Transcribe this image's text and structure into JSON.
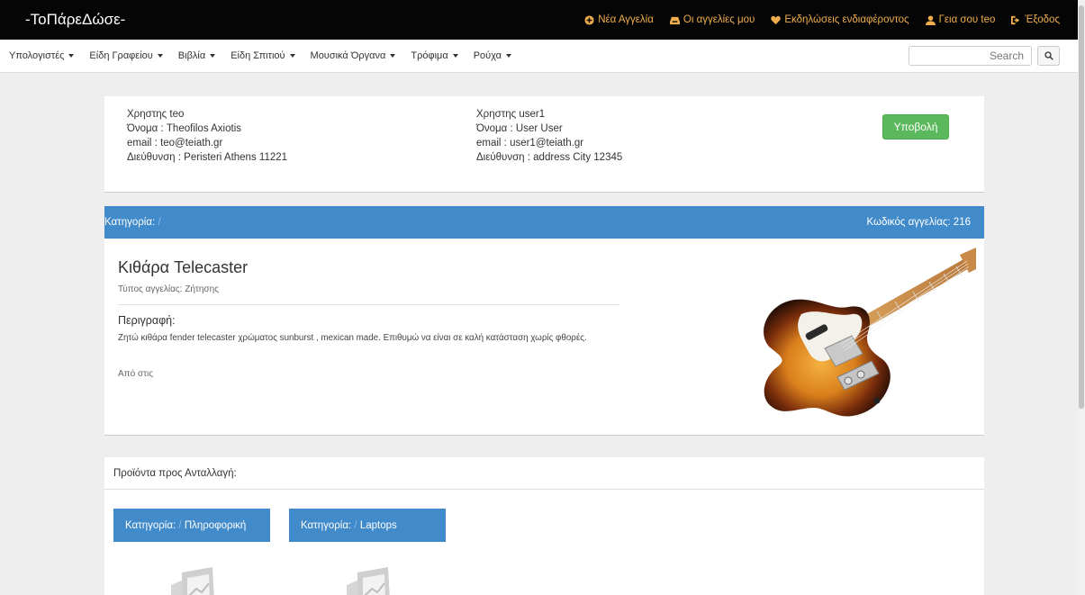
{
  "brand": "-ΤοΠάρεΔώσε-",
  "top_links": {
    "new_ad": "Νέα Αγγελία",
    "my_ads": "Οι αγγελίες μου",
    "interests": "Εκδηλώσεις ενδιαφέροντος",
    "greeting": "Γεια σου teo",
    "logout": "Έξοδος"
  },
  "categories": [
    "Υπολογιστές",
    "Είδη Γραφείου",
    "Βιβλία",
    "Είδη Σπιτιού",
    "Μουσικά Όργανα",
    "Τρόφιμα",
    "Ρούχα"
  ],
  "search": {
    "placeholder": "Search"
  },
  "user_a": {
    "line1": "Χρηστης teo",
    "line2": "Όνομα : Theofilos Axiotis",
    "line3": "email : teo@teiath.gr",
    "line4": "Διεύθυνση : Peristeri Athens 11221"
  },
  "user_b": {
    "line1": "Χρηστης user1",
    "line2": "Όνομα : User User",
    "line3": "email : user1@teiath.gr",
    "line4": "Διεύθυνση : address City 12345"
  },
  "submit_label": "Υποβολή",
  "ad": {
    "category_label": "Κατηγορία:",
    "category_sep": "/",
    "code_label": "Κωδικός αγγελίας: 216",
    "title": "Κιθάρα Telecaster",
    "type": "Τύπος αγγελίας: Ζήτησης",
    "desc_label": "Περιγραφή:",
    "desc": "Ζητώ κιθάρα fender telecaster χρώματος sunburst , mexican made. Επιθυμώ να είναι σε καλή κατάσταση χωρίς φθορές.",
    "from": "Από στις"
  },
  "exchange": {
    "title": "Προϊόντα προς Ανταλλαγή:",
    "tiles": [
      {
        "label": "Κατηγορία:",
        "sep": "/",
        "value": "Πληροφορική"
      },
      {
        "label": "Κατηγορία:",
        "sep": "/",
        "value": "Laptops"
      }
    ]
  },
  "colors": {
    "accent": "#428bca",
    "submit": "#5cb85c",
    "toplink": "#f0ad4e",
    "navbar": "#050505"
  }
}
